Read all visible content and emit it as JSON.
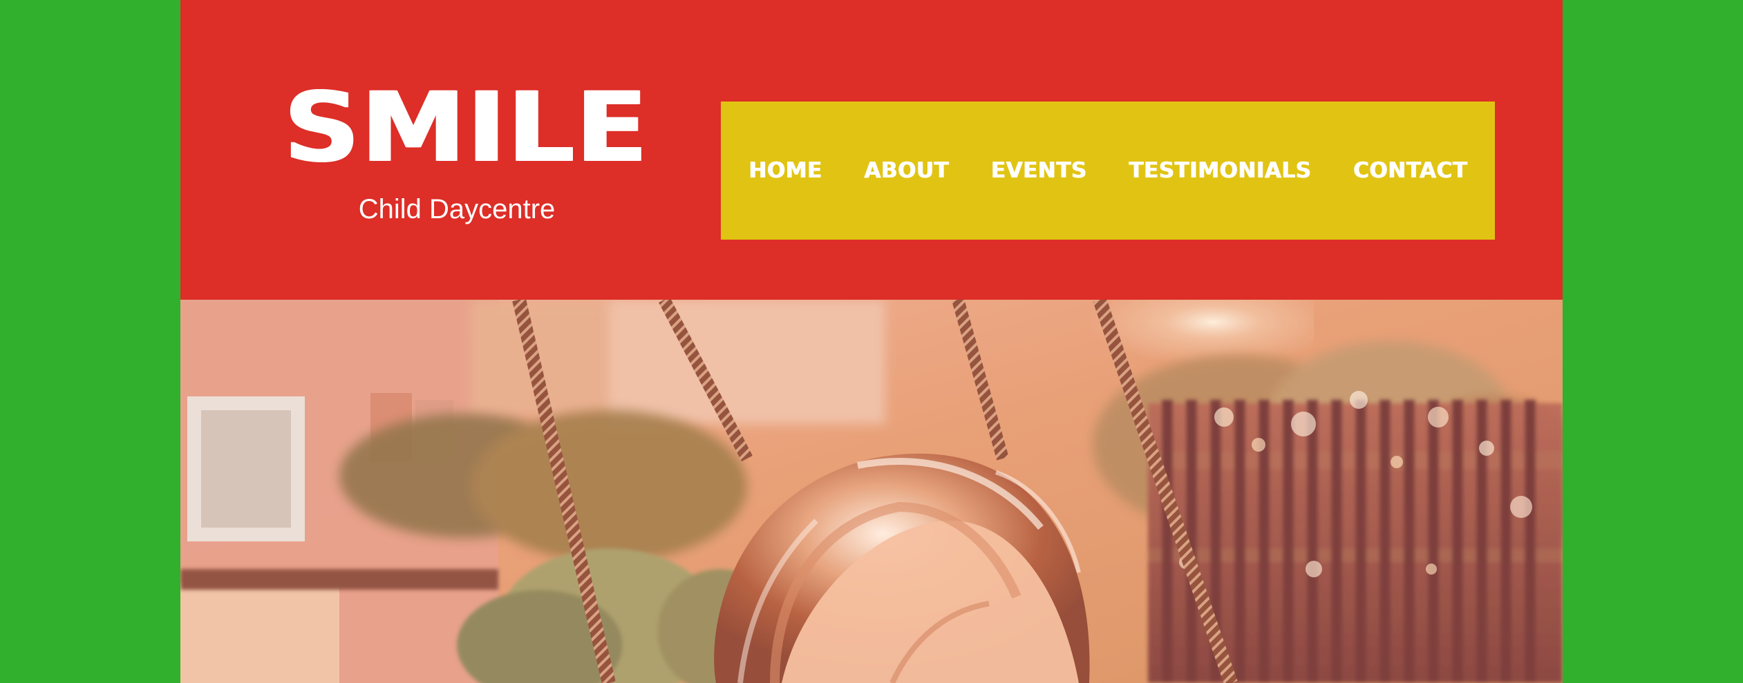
{
  "brand": {
    "title": "SMILE",
    "subtitle": "Child Daycentre"
  },
  "nav": {
    "items": [
      {
        "label": "HOME"
      },
      {
        "label": "ABOUT"
      },
      {
        "label": "EVENTS"
      },
      {
        "label": "TESTIMONIALS"
      },
      {
        "label": "CONTACT"
      }
    ]
  },
  "colors": {
    "background": "#30b02c",
    "header": "#dd2e27",
    "nav": "#e1c413",
    "text": "#ffffff"
  }
}
